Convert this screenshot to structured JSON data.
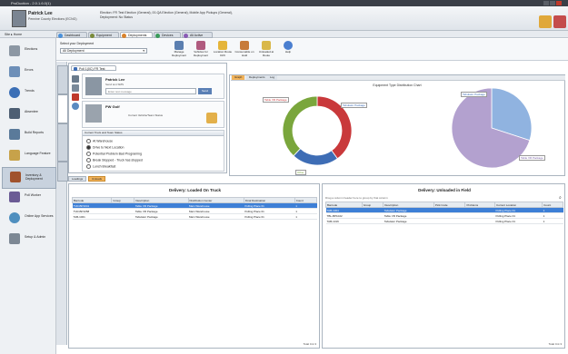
{
  "window": {
    "title": "ProDuction - 2.0.1.6.0(1)"
  },
  "user": {
    "name": "Patrick Lee",
    "location": "Pennine County Elections (ECNG)"
  },
  "header_info": {
    "line1": "Election: FR Test Election (General), 00-QA Election (General), Mobile App Pickups (General),",
    "line2": "Deployment: No Status"
  },
  "nav": {
    "home": "Home",
    "breadcrumb": "Site"
  },
  "tabs": [
    "Dashboard",
    "Equipment",
    "Deployments",
    "Devices",
    "All Active"
  ],
  "sidebar": [
    {
      "label": "Elections"
    },
    {
      "label": "Errors"
    },
    {
      "label": "Trends"
    },
    {
      "label": "Absentee"
    },
    {
      "label": "Build Reports"
    },
    {
      "label": "Language Feature"
    },
    {
      "label": "Inventory & Deployment"
    },
    {
      "label": "Poll Worker"
    },
    {
      "label": "Online App Services"
    },
    {
      "label": "Setup & Admin"
    }
  ],
  "ribbon": {
    "deployment_label": "Select your Deployment",
    "deployment_value": "All Deployment",
    "buttons": [
      {
        "label": "Manage Deployment"
      },
      {
        "label": "Vehicles for Deployment"
      },
      {
        "label": "Location Route Drift"
      },
      {
        "label": "Consumable on Hold"
      },
      {
        "label": "Unloaded at Route"
      },
      {
        "label": "Help"
      }
    ]
  },
  "left_panel": {
    "tab": "Poll 1(0C) FR Test",
    "contact_name": "Patrick Lee",
    "contact_sub": "Send text SMS",
    "message_placeholder": "Enter text message",
    "send_label": "Send",
    "vehicle": "PW Golf",
    "vehicle_status": "Current Vehicle/Team Status",
    "status_header": "Current Truck and Team Status",
    "statuses": [
      "At Warehouse",
      "Drive to Next Location",
      "Potential Problem Bad Programing",
      "Break Stopped - Truck has stopped",
      "Lunch Breakfast"
    ]
  },
  "chart_panel": {
    "tabs": [
      "Graph",
      "Deployments",
      "Log"
    ],
    "title": "Equipment Type Distribution Chart"
  },
  "chart_data": [
    {
      "type": "pie",
      "style": "donut",
      "categories": [
        "Table VR Package",
        "Tabulator Package",
        "Other"
      ],
      "values": [
        40,
        22,
        38
      ],
      "colors": [
        "#c9393b",
        "#3e6db5",
        "#7aa63c"
      ]
    },
    {
      "type": "pie",
      "categories": [
        "Tabulator Package",
        "Table VR Package"
      ],
      "values": [
        30,
        70
      ],
      "colors": [
        "#90b3e0",
        "#b3a1cf"
      ]
    }
  ],
  "footer_tabs": [
    "Loadings",
    "Unloads"
  ],
  "loaded_grid": {
    "title": "Delivery: Loaded On Truck",
    "columns": [
      "Barcode",
      "Group",
      "Description",
      "Distribution Center",
      "Final Destination",
      "Count"
    ],
    "rows": [
      [
        "TVR-BP1041",
        "",
        "Table VR Package",
        "Main Warehouse",
        "Polling Place 01",
        "1"
      ],
      [
        "TVR-BP1058",
        "",
        "Table VR Package",
        "Main Warehouse",
        "Polling Place 01",
        "1"
      ],
      [
        "TAB-1001",
        "",
        "Tabulator Package",
        "Main Warehouse",
        "Polling Place 01",
        "1"
      ]
    ],
    "footer": "Total Cnt 3"
  },
  "unloaded_grid": {
    "title": "Delivery: Unloaded in Field",
    "group_hint": "Drag a column header here to group by that column",
    "columns": [
      "Barcode",
      "Group",
      "Description",
      "Pick Code",
      "Problems",
      "Current Location",
      "Count"
    ],
    "rows": [
      [
        "TAB-1004",
        "",
        "Tabulator Package",
        "",
        "",
        "Polling Place 01",
        "1"
      ],
      [
        "TBL-BP1022",
        "",
        "Table VR Package",
        "",
        "",
        "Polling Place 01",
        "1"
      ],
      [
        "TAB-1016",
        "",
        "Tabulator Package",
        "",
        "",
        "Polling Place 01",
        "1"
      ]
    ],
    "footer": "Total Cnt 3"
  },
  "colors": {
    "accent": "#3d7fd6",
    "header_bg": "#3a3f47",
    "selected_row": "#3d7fd6"
  }
}
